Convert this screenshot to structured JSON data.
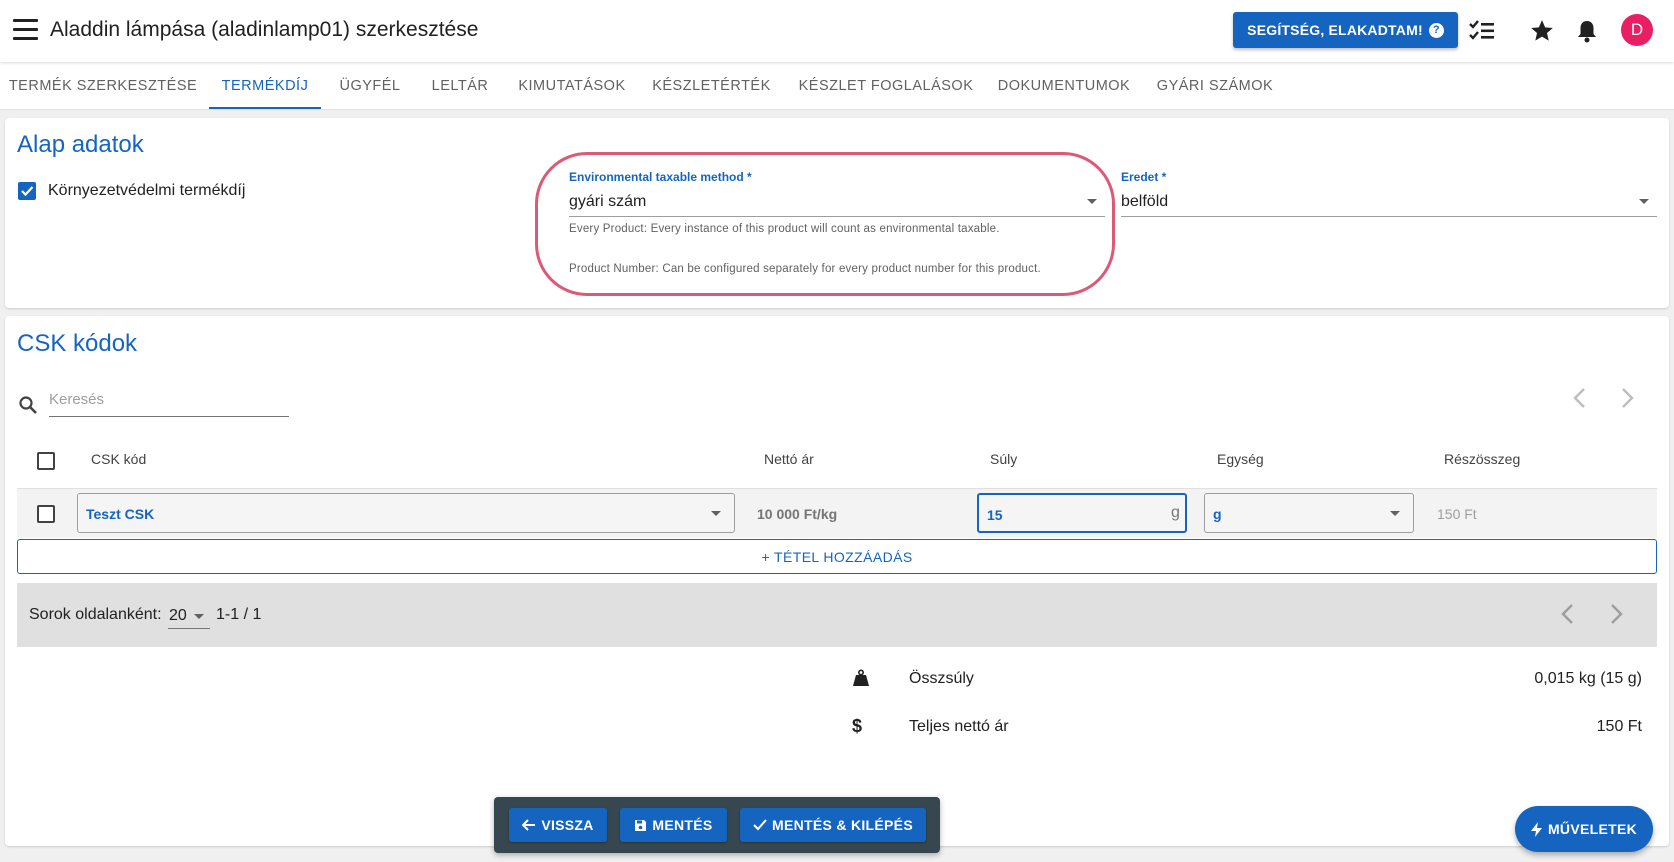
{
  "header": {
    "title": "Aladdin lámpása (aladinlamp01) szerkesztése",
    "help_button": "SEGÍTSÉG, ELAKADTAM!",
    "avatar_initial": "D"
  },
  "tabs": [
    {
      "label": "TERMÉK SZERKESZTÉSE"
    },
    {
      "label": "TERMÉKDÍJ"
    },
    {
      "label": "ÜGYFÉL"
    },
    {
      "label": "LELTÁR"
    },
    {
      "label": "KIMUTATÁSOK"
    },
    {
      "label": "KÉSZLETÉRTÉK"
    },
    {
      "label": "KÉSZLET FOGLALÁSOK"
    },
    {
      "label": "DOKUMENTUMOK"
    },
    {
      "label": "GYÁRI SZÁMOK"
    }
  ],
  "basic": {
    "title": "Alap adatok",
    "checkbox_label": "Környezetvédelmi termékdíj",
    "method_label": "Environmental taxable method *",
    "method_value": "gyári szám",
    "hint1": "Every Product: Every instance of this product will count as environmental taxable.",
    "hint2": "Product Number: Can be configured separately for every product number for this product.",
    "origin_label": "Eredet *",
    "origin_value": "belföld"
  },
  "csk": {
    "title": "CSK kódok",
    "search_placeholder": "Keresés",
    "columns": {
      "code": "CSK kód",
      "net_price": "Nettó ár",
      "weight": "Súly",
      "unit": "Egység",
      "subtotal": "Részösszeg"
    },
    "rows": [
      {
        "code": "Teszt CSK",
        "net_price": "10 000 Ft/kg",
        "weight": "15",
        "weight_suffix": "g",
        "unit": "g",
        "subtotal": "150 Ft"
      }
    ],
    "add_button": "+ TÉTEL HOZZÁADÁS",
    "rows_per_page_label": "Sorok oldalanként:",
    "rows_per_page": "20",
    "page_info": "1-1 / 1"
  },
  "summary": {
    "total_weight_label": "Összsúly",
    "total_weight_value": "0,015 kg (15 g)",
    "total_net_label": "Teljes nettó ár",
    "total_net_value": "150 Ft"
  },
  "actions": {
    "back": "VISSZA",
    "save": "MENTÉS",
    "save_exit": "MENTÉS & KILÉPÉS",
    "operations": "MŰVELETEK"
  },
  "colors": {
    "primary": "#1565c0",
    "highlight": "#dc5a77",
    "avatar": "#e91e63"
  }
}
